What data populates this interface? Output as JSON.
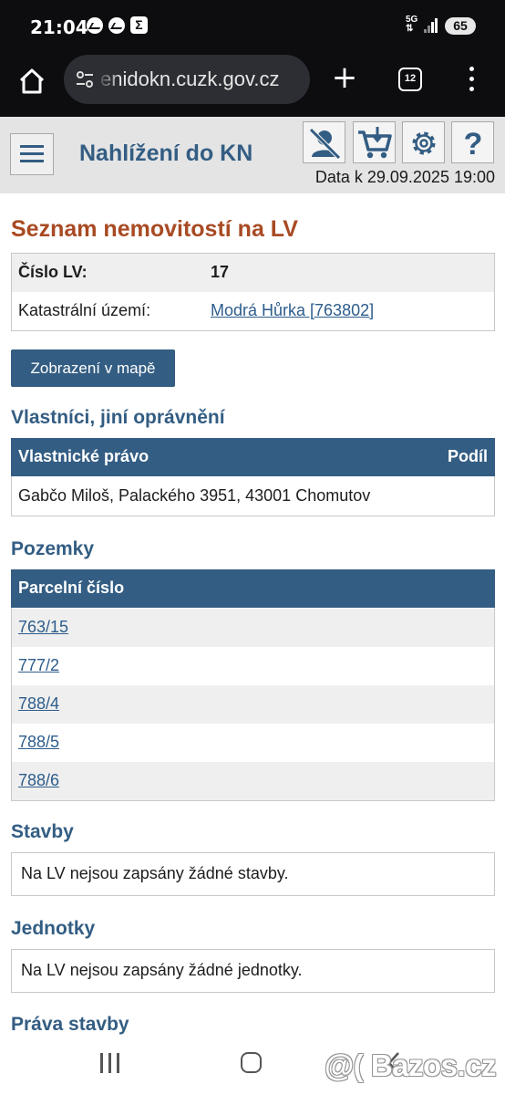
{
  "status_bar": {
    "time": "21:04",
    "network": "5G",
    "battery": "65",
    "icons": [
      "messenger-icon",
      "messenger-icon",
      "sigma-icon",
      "signal-icon"
    ]
  },
  "browser": {
    "url": "enidokn.cuzk.gov.cz",
    "tab_count": "12",
    "icons": [
      "home-icon",
      "site-settings-icon",
      "new-tab-icon",
      "tabs-icon",
      "overflow-menu-icon"
    ]
  },
  "header": {
    "title": "Nahlížení do KN",
    "data_date": "Data k 29.09.2025 19:00",
    "icons": [
      "menu-icon",
      "user-off-icon",
      "cart-icon",
      "gear-icon",
      "help-icon"
    ]
  },
  "page": {
    "title": "Seznam nemovitostí na LV",
    "info": {
      "lv_label": "Číslo LV:",
      "lv_value": "17",
      "ku_label": "Katastrální území:",
      "ku_value": "Modrá Hůrka [763802]"
    },
    "map_button": "Zobrazení v mapě",
    "owners": {
      "title": "Vlastníci, jiní oprávnění",
      "col_right": "Vlastnické právo",
      "col_share": "Podíl",
      "rows": [
        "Gabčo Miloš, Palackého 3951, 43001 Chomutov"
      ]
    },
    "parcels": {
      "title": "Pozemky",
      "col": "Parcelní číslo",
      "rows": [
        "763/15",
        "777/2",
        "788/4",
        "788/5",
        "788/6"
      ]
    },
    "buildings": {
      "title": "Stavby",
      "note": "Na LV nejsou zapsány žádné stavby."
    },
    "units": {
      "title": "Jednotky",
      "note": "Na LV nejsou zapsány žádné jednotky."
    },
    "building_rights": {
      "title": "Práva stavby"
    }
  },
  "watermark": "@( Bazos.cz",
  "colors": {
    "primary": "#335d83",
    "title_accent": "#a84a23",
    "row_stripe": "#efefef"
  }
}
